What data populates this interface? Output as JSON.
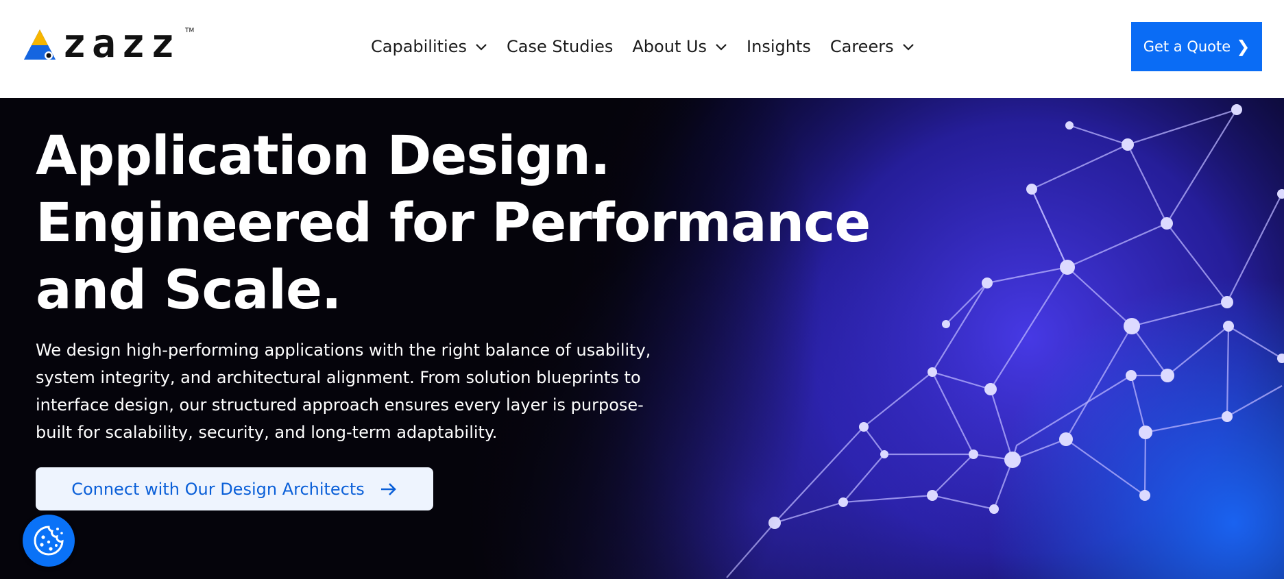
{
  "header": {
    "logo": {
      "wordmark": "zazz",
      "trademark": "TM"
    },
    "nav": [
      {
        "label": "Capabilities",
        "has_dropdown": true
      },
      {
        "label": "Case Studies",
        "has_dropdown": false
      },
      {
        "label": "About Us",
        "has_dropdown": true
      },
      {
        "label": "Insights",
        "has_dropdown": false
      },
      {
        "label": "Careers",
        "has_dropdown": true
      }
    ],
    "quote_button": {
      "label": "Get a Quote",
      "arrow": "❯"
    }
  },
  "hero": {
    "title_lines": [
      "Application Design.",
      "Engineered for Performance",
      "and Scale."
    ],
    "description": "We design high-performing applications with the right balance of usability, system integrity, and architectural alignment. From solution blueprints to interface design, our structured approach ensures every layer is purpose-built for scalability, security, and long-term adaptability.",
    "cta": {
      "label": "Connect with Our Design Architects",
      "icon": "arrow-right-icon"
    }
  },
  "cookie_widget": {
    "icon": "cookie-icon"
  },
  "colors": {
    "brand_blue": "#0a6cf5",
    "hero_background": "#05040b",
    "cta_background": "#eef4fe",
    "cta_text": "#0a5fd8",
    "logo_yellow": "#f7b500",
    "logo_blue": "#1565e0"
  }
}
